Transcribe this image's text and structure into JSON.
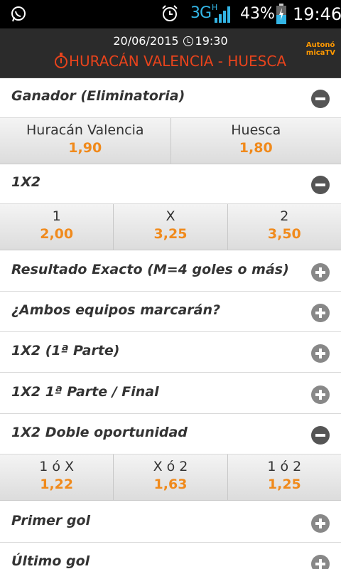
{
  "status_bar": {
    "network": "3G",
    "network_sub": "H",
    "battery": "43%",
    "time": "19:46",
    "icons": [
      "whatsapp-icon",
      "alarm-icon",
      "signal-icon",
      "battery-icon"
    ]
  },
  "header": {
    "date": "20/06/2015",
    "time": "19:30",
    "match": "HURACÁN VALENCIA - HUESCA",
    "brand_line1": "Autonó",
    "brand_line2": "micaTV"
  },
  "colors": {
    "accent_orange": "#f08a1c",
    "match_red": "#e8431c",
    "header_bg": "#2b2b2b"
  },
  "markets": [
    {
      "title": "Ganador (Eliminatoria)",
      "expanded": true,
      "options": [
        {
          "label": "Huracán Valencia",
          "odd": "1,90"
        },
        {
          "label": "Huesca",
          "odd": "1,80"
        }
      ]
    },
    {
      "title": "1X2",
      "expanded": true,
      "options": [
        {
          "label": "1",
          "odd": "2,00"
        },
        {
          "label": "X",
          "odd": "3,25"
        },
        {
          "label": "2",
          "odd": "3,50"
        }
      ]
    },
    {
      "title": "Resultado Exacto (M=4 goles o más)",
      "expanded": false
    },
    {
      "title": "¿Ambos equipos marcarán?",
      "expanded": false
    },
    {
      "title": "1X2 (1ª Parte)",
      "expanded": false
    },
    {
      "title": "1X2 1ª Parte / Final",
      "expanded": false
    },
    {
      "title": "1X2 Doble oportunidad",
      "expanded": true,
      "options": [
        {
          "label": "1 ó X",
          "odd": "1,22"
        },
        {
          "label": "X ó 2",
          "odd": "1,63"
        },
        {
          "label": "1 ó 2",
          "odd": "1,25"
        }
      ]
    },
    {
      "title": "Primer gol",
      "expanded": false
    },
    {
      "title": "Último gol",
      "expanded": false
    }
  ]
}
